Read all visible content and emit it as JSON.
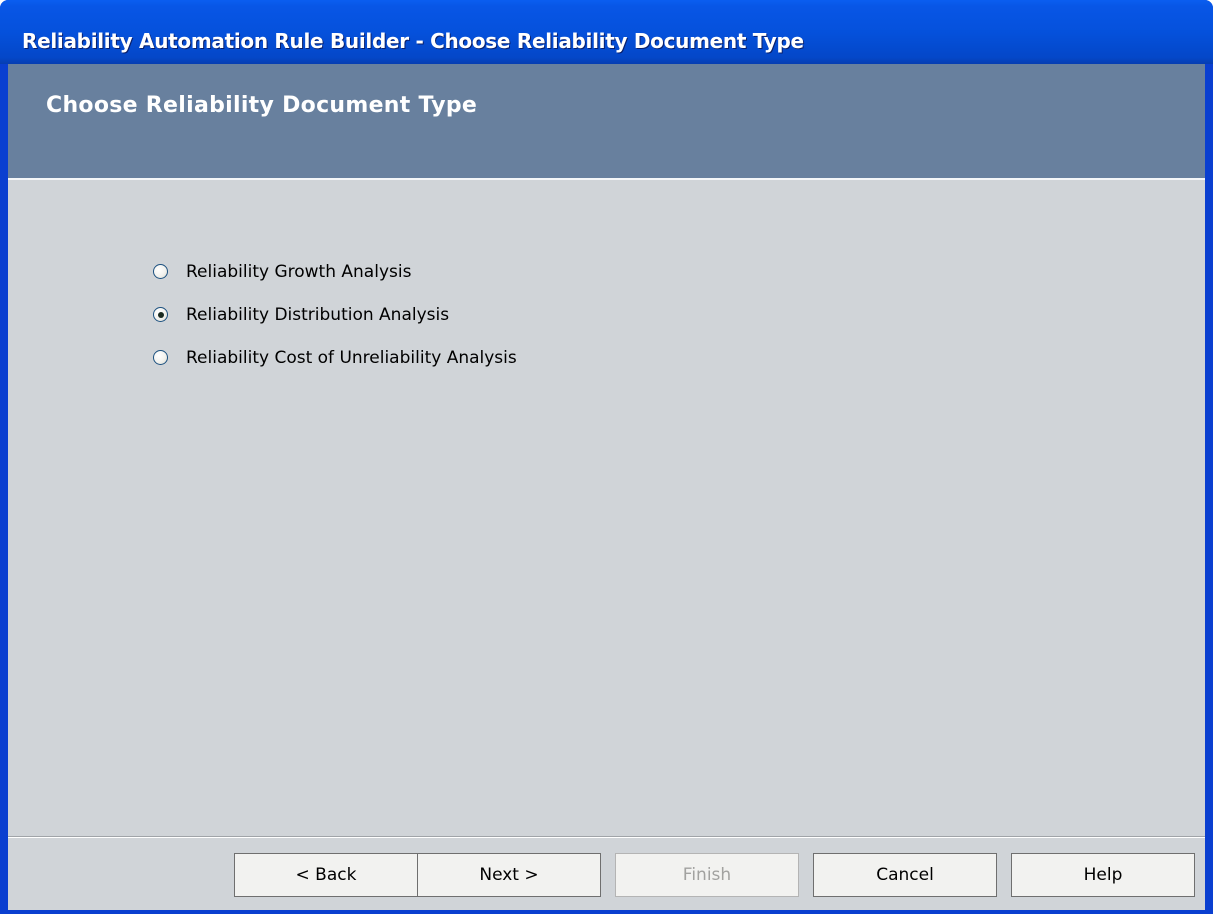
{
  "window": {
    "title": "Reliability Automation Rule Builder - Choose Reliability Document Type"
  },
  "header": {
    "title": "Choose Reliability Document Type"
  },
  "options": [
    {
      "label": "Reliability Growth Analysis",
      "checked": false
    },
    {
      "label": "Reliability Distribution Analysis",
      "checked": true
    },
    {
      "label": "Reliability Cost of Unreliability Analysis",
      "checked": false
    }
  ],
  "buttons": {
    "back": "< Back",
    "next": "Next >",
    "finish": "Finish",
    "cancel": "Cancel",
    "help": "Help"
  },
  "states": {
    "finish_enabled": false
  },
  "colors": {
    "titlebar": "#0551dc",
    "header_band": "#68809e",
    "client_background": "#d0d4d8"
  }
}
